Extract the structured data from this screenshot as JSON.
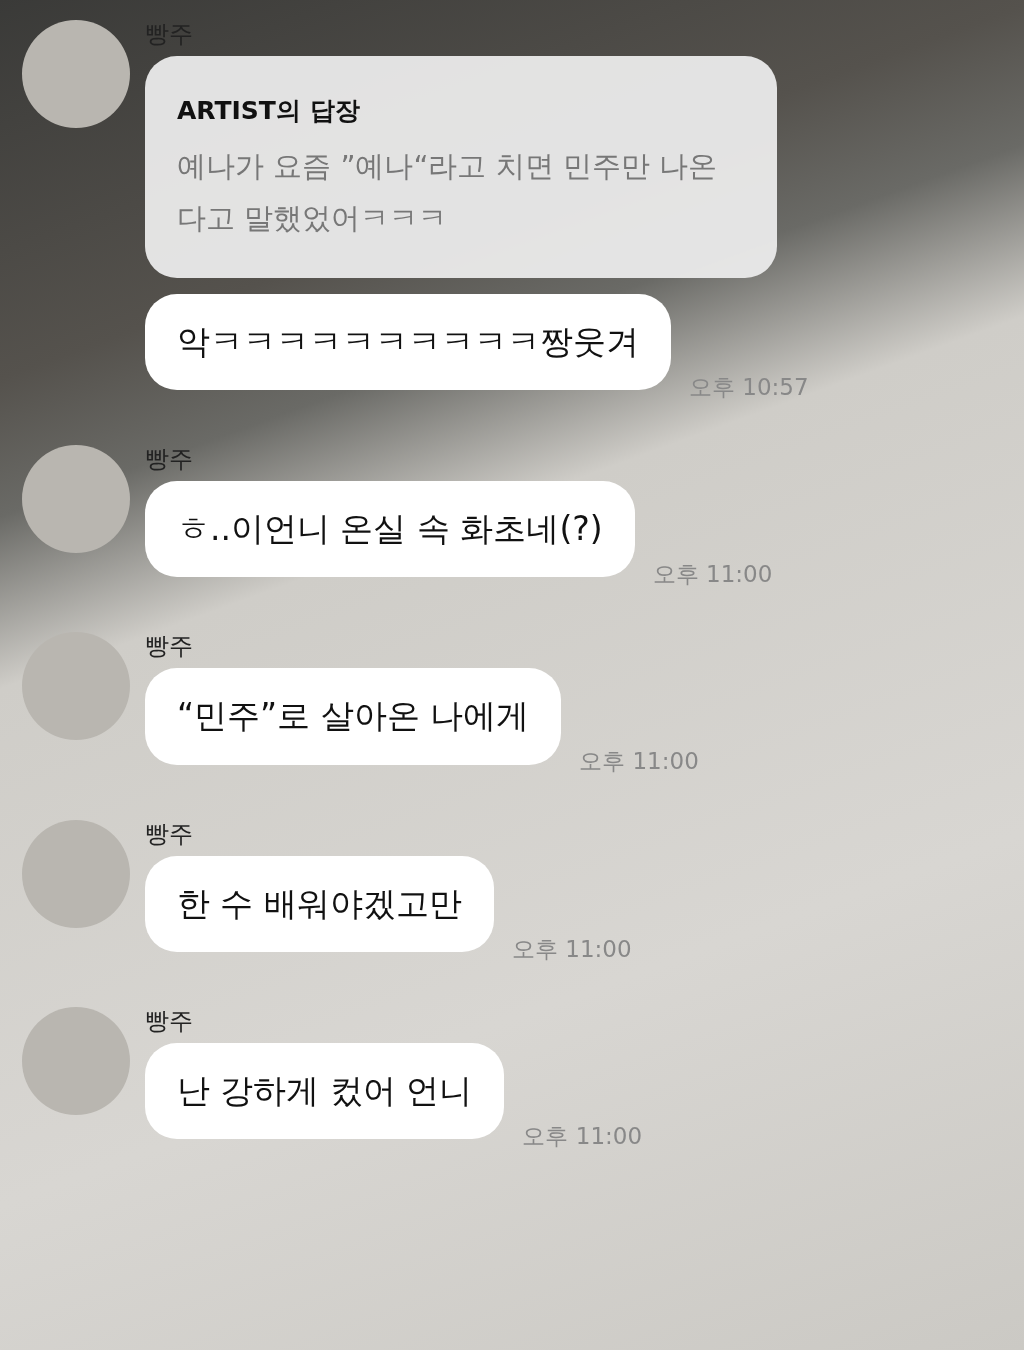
{
  "groups": [
    {
      "sender": "빵주",
      "messages": [
        {
          "kind": "reply",
          "title": "ARTIST의 답장",
          "text": "예나가 요즘 ”예나“라고 치면 민주만 나온다고 말했었어ㅋㅋㅋ"
        },
        {
          "kind": "text",
          "text": "악ㅋㅋㅋㅋㅋㅋㅋㅋㅋㅋ짱웃겨",
          "time": "오후 10:57"
        }
      ]
    },
    {
      "sender": "빵주",
      "messages": [
        {
          "kind": "text",
          "text": "ㅎ..이언니 온실 속 화초네(?)",
          "time": "오후 11:00"
        }
      ]
    },
    {
      "sender": "빵주",
      "messages": [
        {
          "kind": "text",
          "text": "“민주”로 살아온 나에게",
          "time": "오후 11:00"
        }
      ]
    },
    {
      "sender": "빵주",
      "messages": [
        {
          "kind": "text",
          "text": "한 수 배워야겠고만",
          "time": "오후 11:00"
        }
      ]
    },
    {
      "sender": "빵주",
      "messages": [
        {
          "kind": "text",
          "text": "난 강하게 컸어 언니",
          "time": "오후 11:00"
        }
      ]
    }
  ]
}
